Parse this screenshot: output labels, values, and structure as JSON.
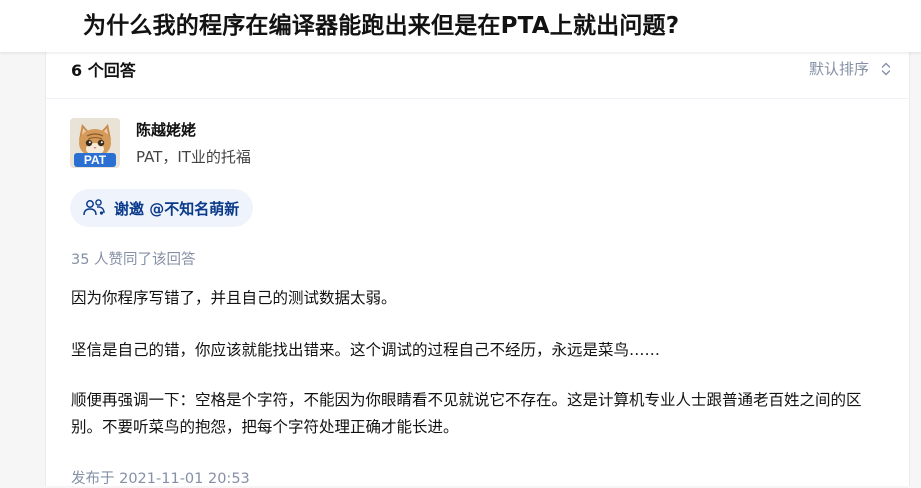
{
  "question": {
    "title": "为什么我的程序在编译器能跑出来但是在PTA上就出问题?"
  },
  "answers_header": {
    "count_label": "6 个回答",
    "sort_label": "默认排序"
  },
  "answer": {
    "author": {
      "name": "陈越姥姥",
      "bio": "PAT，IT业的托福",
      "avatar_text": "PAT"
    },
    "invite": {
      "label": "谢邀 @不知名萌新"
    },
    "votes_label": "35 人赞同了该回答",
    "paragraphs": [
      "因为你程序写错了，并且自己的测试数据太弱。",
      "坚信是自己的错，你应该就能找出错来。这个调试的过程自己不经历，永远是菜鸟……",
      "顺便再强调一下：空格是个字符，不能因为你眼睛看不见就说它不存在。这是计算机专业人士跟普通老百姓之间的区别。不要听菜鸟的抱怨，把每个字符处理正确才能长进。"
    ],
    "published": "发布于 2021-11-01 20:53"
  },
  "colors": {
    "accent": "#0a3a8a",
    "invite_bg": "#eef3fc",
    "muted": "#8590a6",
    "text": "#121212"
  },
  "icons": {
    "sort": "chevron-up-down-icon",
    "invite": "people-icon"
  }
}
